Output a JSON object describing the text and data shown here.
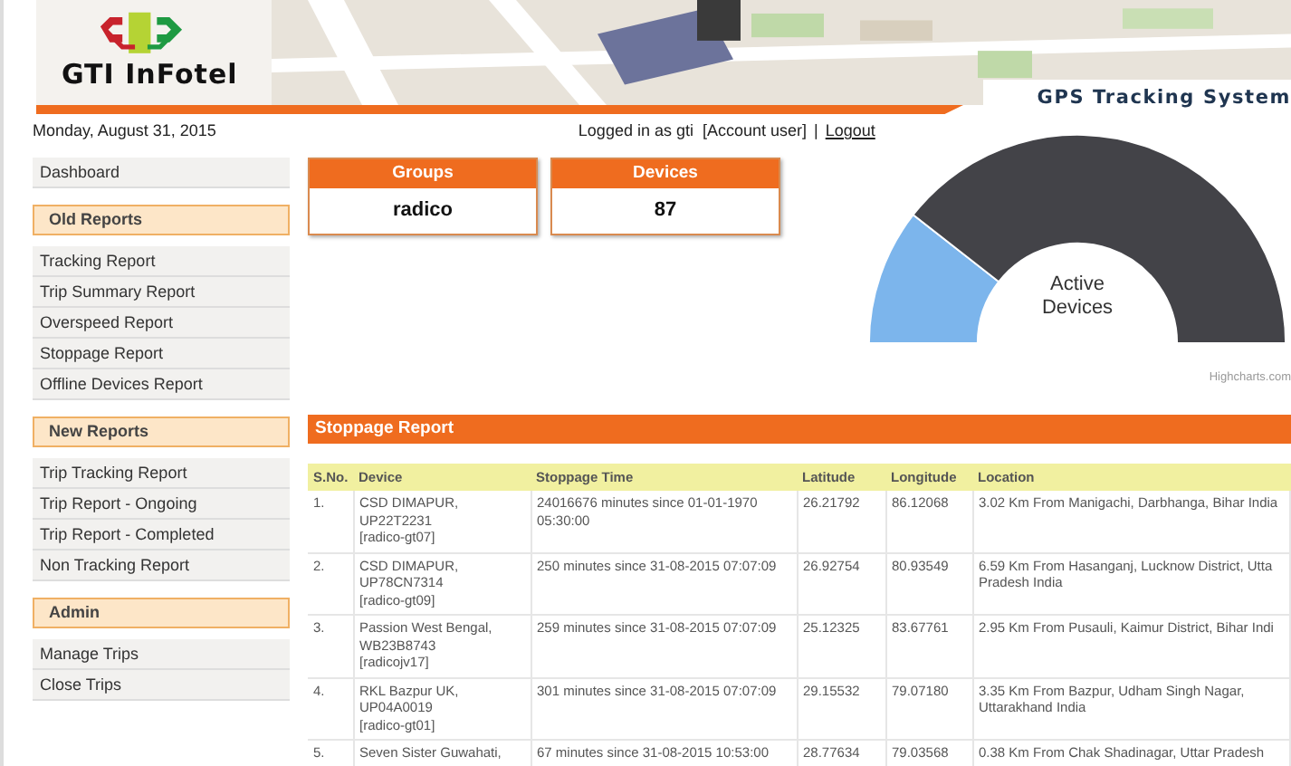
{
  "header": {
    "logo_text": "GTI InFotel",
    "title": "GPS Tracking System"
  },
  "top_bar": {
    "date": "Monday, August 31, 2015",
    "login_text": "Logged in as gti  [Account user]",
    "separator": "|",
    "logout": "Logout"
  },
  "sidebar": {
    "items": [
      {
        "kind": "item",
        "label": "Dashboard"
      },
      {
        "kind": "section",
        "label": "Old Reports"
      },
      {
        "kind": "item",
        "label": "Tracking Report"
      },
      {
        "kind": "item",
        "label": "Trip Summary Report"
      },
      {
        "kind": "item",
        "label": "Overspeed Report"
      },
      {
        "kind": "item",
        "label": "Stoppage Report"
      },
      {
        "kind": "item",
        "label": "Offline Devices Report"
      },
      {
        "kind": "section",
        "label": "New Reports"
      },
      {
        "kind": "item",
        "label": "Trip Tracking Report"
      },
      {
        "kind": "item",
        "label": "Trip Report - Ongoing"
      },
      {
        "kind": "item",
        "label": "Trip Report - Completed"
      },
      {
        "kind": "item",
        "label": "Non Tracking Report"
      },
      {
        "kind": "section",
        "label": "Admin"
      },
      {
        "kind": "item",
        "label": "Manage Trips"
      },
      {
        "kind": "item",
        "label": "Close Trips"
      }
    ]
  },
  "cards": [
    {
      "title": "Groups",
      "value": "radico"
    },
    {
      "title": "Devices",
      "value": "87"
    }
  ],
  "gauge": {
    "label": "Active Devices",
    "credit": "Highcharts.com"
  },
  "report": {
    "title": "Stoppage Report",
    "columns": [
      "S.No.",
      "Device",
      "Stoppage Time",
      "Latitude",
      "Longitude",
      "Location"
    ],
    "rows": [
      {
        "sno": "1.",
        "device": "CSD DIMAPUR, UP22T2231",
        "device_id": "[radico-gt07]",
        "time": "24016676 minutes since 01-01-1970 05:30:00",
        "lat": "26.21792",
        "lon": "86.12068",
        "location": "3.02 Km From Manigachi, Darbhanga, Bihar India"
      },
      {
        "sno": "2.",
        "device": "CSD DIMAPUR, UP78CN7314",
        "device_id": "[radico-gt09]",
        "time": "250 minutes since 31-08-2015 07:07:09",
        "lat": "26.92754",
        "lon": "80.93549",
        "location": "6.59 Km From Hasanganj, Lucknow District, Utta Pradesh India"
      },
      {
        "sno": "3.",
        "device": "Passion West Bengal, WB23B8743",
        "device_id": "[radicojv17]",
        "time": "259 minutes since 31-08-2015 07:07:09",
        "lat": "25.12325",
        "lon": "83.67761",
        "location": "2.95 Km From Pusauli, Kaimur District, Bihar Indi"
      },
      {
        "sno": "4.",
        "device": "RKL Bazpur UK, UP04A0019",
        "device_id": "[radico-gt01]",
        "time": "301 minutes since 31-08-2015 07:07:09",
        "lat": "29.15532",
        "lon": "79.07180",
        "location": "3.35 Km From Bazpur, Udham Singh Nagar, Uttarakhand India"
      },
      {
        "sno": "5.",
        "device": "Seven Sister Guwahati,",
        "time": "67 minutes since 31-08-2015 10:53:00",
        "lat": "28.77634",
        "lon": "79.03568",
        "location": "0.38 Km From Chak Shadinagar, Uttar Pradesh"
      }
    ]
  }
}
